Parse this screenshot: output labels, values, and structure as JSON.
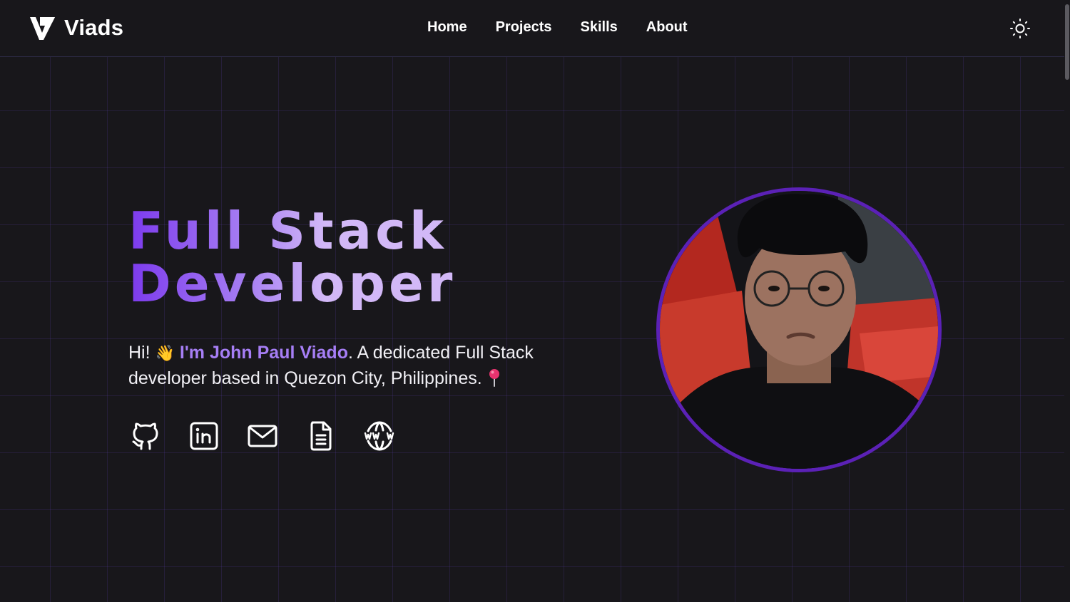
{
  "header": {
    "brand_name": "Viads",
    "logo_icon": "v-logo-icon",
    "nav": [
      {
        "label": "Home"
      },
      {
        "label": "Projects"
      },
      {
        "label": "Skills"
      },
      {
        "label": "About"
      }
    ],
    "theme_toggle_icon": "sun-icon"
  },
  "hero": {
    "title_line1": "Full Stack",
    "title_line2": "Developer",
    "intro_hi": "Hi!",
    "intro_wave_emoji": "👋",
    "intro_name": "I'm John Paul Viado",
    "intro_rest": ". A dedicated Full Stack developer based in Quezon City, Philippines.",
    "intro_pin_icon": "pin-icon"
  },
  "socials": [
    {
      "icon": "github-icon"
    },
    {
      "icon": "linkedin-icon"
    },
    {
      "icon": "mail-icon"
    },
    {
      "icon": "resume-document-icon"
    },
    {
      "icon": "website-globe-icon"
    }
  ],
  "colors": {
    "background": "#18171b",
    "accent_purple": "#7c3aed",
    "accent_light": "#d2b8f7",
    "highlight": "#a67ef5",
    "avatar_ring": "#5b21b6"
  }
}
